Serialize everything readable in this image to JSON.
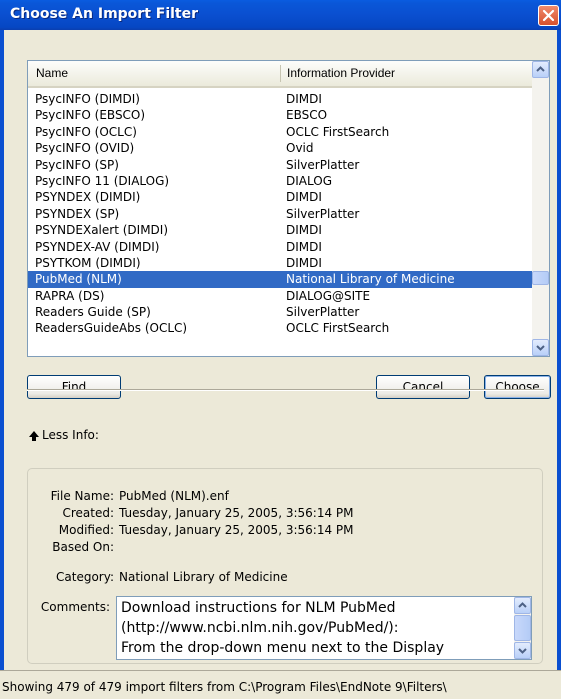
{
  "window": {
    "title": "Choose An Import Filter",
    "close_icon": "close-icon"
  },
  "list": {
    "columns": [
      "Name",
      "Information Provider"
    ],
    "rows": [
      {
        "name": "PsycINFO (DIMDI)",
        "provider": "DIMDI"
      },
      {
        "name": "PsycINFO (EBSCO)",
        "provider": "EBSCO"
      },
      {
        "name": "PsycINFO (OCLC)",
        "provider": "OCLC FirstSearch"
      },
      {
        "name": "PsycINFO (OVID)",
        "provider": "Ovid"
      },
      {
        "name": "PsycINFO (SP)",
        "provider": "SilverPlatter"
      },
      {
        "name": "PsycINFO 11 (DIALOG)",
        "provider": "DIALOG"
      },
      {
        "name": "PSYNDEX (DIMDI)",
        "provider": "DIMDI"
      },
      {
        "name": "PSYNDEX (SP)",
        "provider": "SilverPlatter"
      },
      {
        "name": "PSYNDEXalert (DIMDI)",
        "provider": "DIMDI"
      },
      {
        "name": "PSYNDEX-AV (DIMDI)",
        "provider": "DIMDI"
      },
      {
        "name": "PSYTKOM (DIMDI)",
        "provider": "DIMDI"
      },
      {
        "name": "PubMed (NLM)",
        "provider": "National Library of Medicine",
        "selected": true
      },
      {
        "name": "RAPRA (DS)",
        "provider": "DIALOG@SITE"
      },
      {
        "name": "Readers Guide (SP)",
        "provider": "SilverPlatter"
      },
      {
        "name": "ReadersGuideAbs (OCLC)",
        "provider": "OCLC FirstSearch"
      }
    ],
    "scroll_position": 0.78
  },
  "buttons": {
    "find": "Find",
    "cancel": "Cancel",
    "choose": "Choose"
  },
  "less_info": {
    "label": "Less Info:",
    "icon": "up-arrow-icon"
  },
  "details": {
    "file_name_label": "File Name:",
    "file_name": "PubMed (NLM).enf",
    "created_label": "Created:",
    "created": "Tuesday, January 25, 2005, 3:56:14 PM",
    "modified_label": "Modified:",
    "modified": "Tuesday, January 25, 2005, 3:56:14 PM",
    "based_on_label": "Based On:",
    "based_on": "",
    "category_label": "Category:",
    "category": "National Library of Medicine",
    "comments_label": "Comments:",
    "comments": "Download instructions for NLM PubMed\n(http://www.ncbi.nlm.nih.gov/PubMed/):\nFrom the drop-down menu next to the Display"
  },
  "status": {
    "text": "Showing 479 of 479 import filters from C:\\Program Files\\EndNote 9\\Filters\\"
  },
  "colors": {
    "titlebar": "#0a4fd0",
    "selection": "#316ac5",
    "close_button": "#d7502c"
  }
}
